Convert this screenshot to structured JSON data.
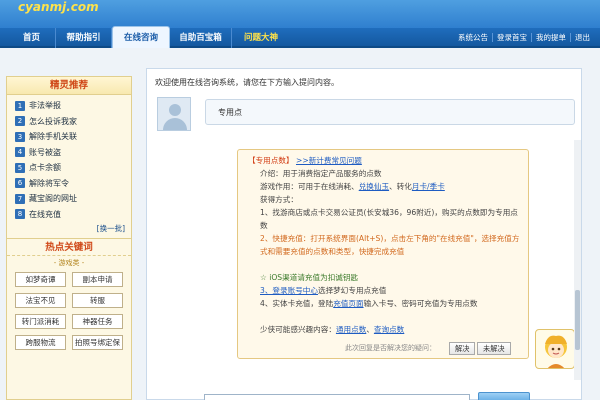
{
  "logo": {
    "text": "cyanmj.com"
  },
  "nav": {
    "items": [
      "首页",
      "帮助指引",
      "在线咨询",
      "自助百宝箱",
      "问题大神"
    ],
    "active_index": 2,
    "right_links": [
      "系统公告",
      "登录首宝",
      "我的提单",
      "退出"
    ]
  },
  "sidebar": {
    "title": "精灵推荐",
    "items": [
      {
        "num": "1",
        "label": "非法举报"
      },
      {
        "num": "2",
        "label": "怎么投诉我家"
      },
      {
        "num": "3",
        "label": "解除手机关联"
      },
      {
        "num": "4",
        "label": "账号被盗"
      },
      {
        "num": "5",
        "label": "点卡余额"
      },
      {
        "num": "6",
        "label": "解除将军令"
      },
      {
        "num": "7",
        "label": "藏宝阁的网址"
      },
      {
        "num": "8",
        "label": "在线充值"
      }
    ],
    "refresh_label": "[换一批]",
    "hot_title": "热点关键词",
    "game_label": "- 游戏类 -",
    "hot_keywords": [
      "如梦奇谭",
      "副本申请",
      "法宝不见",
      "转服",
      "转门派消耗",
      "神器任务",
      "跨服物流",
      "拍照号绑定保"
    ]
  },
  "chat": {
    "welcome": "欢迎使用在线咨询系统，请您在下方输入提问内容。",
    "user_question": "专用点",
    "answer": {
      "tag": "【专用点数】",
      "link_more": ">>新计费常见问题",
      "intro": "介绍：用于消费指定产品服务的点数",
      "usage_prefix": "游戏作用：可用于在线消耗、",
      "usage_link1": "兑换仙玉",
      "usage_mid": "、转化",
      "usage_link2": "月卡/季卡",
      "obtain_title": "获得方式：",
      "step1": "1、找游商店或点卡交易公证员(长安城36，96附近)，购买的点数即为专用点数",
      "step2": "2、快捷充值：打开系统界面(Alt+S)，点击左下角的\"在线充值\"，选择充值方式和需要充值的点数和类型，快捷完成充值",
      "step2b": "☆ iOS渠道请充值为扣诚钥匙",
      "step3_link": "3、登录账号中心",
      "step3_rest": "选择梦幻专用点充值",
      "step4_prefix": "4、实体卡充值，登陆",
      "step4_link": "充值页面",
      "step4_rest": "输入卡号、密码可充值为专用点数",
      "interest_prefix": "少侠可能感兴趣内容：",
      "interest_link1": "通用点数",
      "interest_link2": "查询点数"
    },
    "feedback_question": "此次回复是否解决您的疑问：",
    "resolved_label": "解决",
    "unresolved_label": "未解决"
  }
}
